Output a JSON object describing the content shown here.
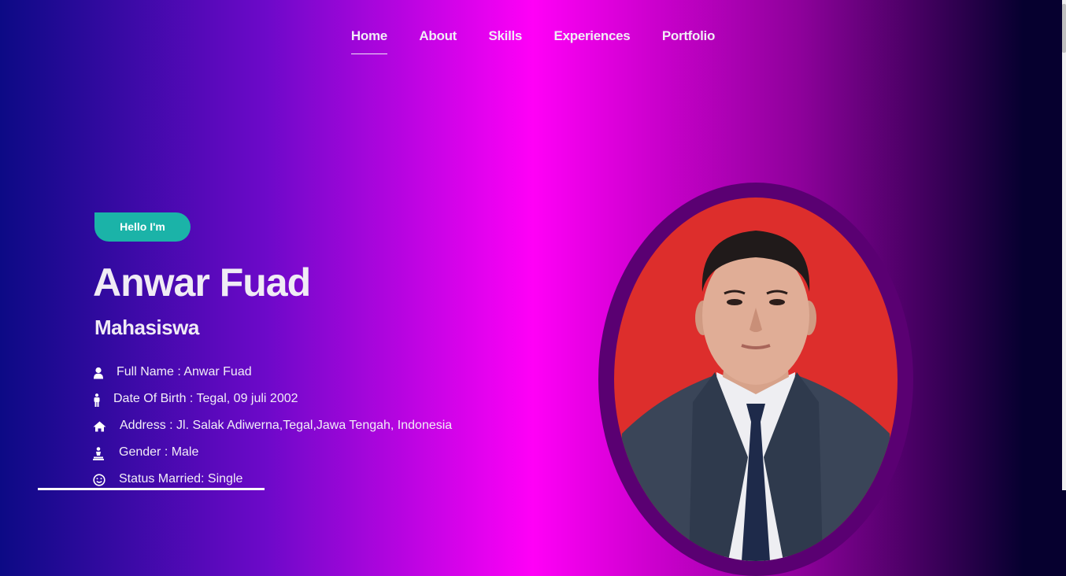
{
  "nav": {
    "items": [
      {
        "label": "Home",
        "active": true
      },
      {
        "label": "About"
      },
      {
        "label": "Skills"
      },
      {
        "label": "Experiences"
      },
      {
        "label": "Portfolio"
      }
    ]
  },
  "hero": {
    "greeting": "Hello I'm",
    "name": "Anwar Fuad",
    "role": "Mahasiswa",
    "info": [
      {
        "icon": "user-icon",
        "text": "Full Name : Anwar Fuad"
      },
      {
        "icon": "person-standing-icon",
        "text": "Date Of Birth : Tegal, 09 juli 2002"
      },
      {
        "icon": "home-icon",
        "text": "Address : Jl. Salak Adiwerna,Tegal,Jawa Tengah, Indonesia"
      },
      {
        "icon": "gender-icon",
        "text": "Gender : Male"
      },
      {
        "icon": "smile-icon",
        "text": "Status Married: Single"
      }
    ]
  },
  "colors": {
    "accent": "#1bb3a8",
    "photo_background": "#dd2e2c",
    "photo_frame": "#5a0072"
  }
}
